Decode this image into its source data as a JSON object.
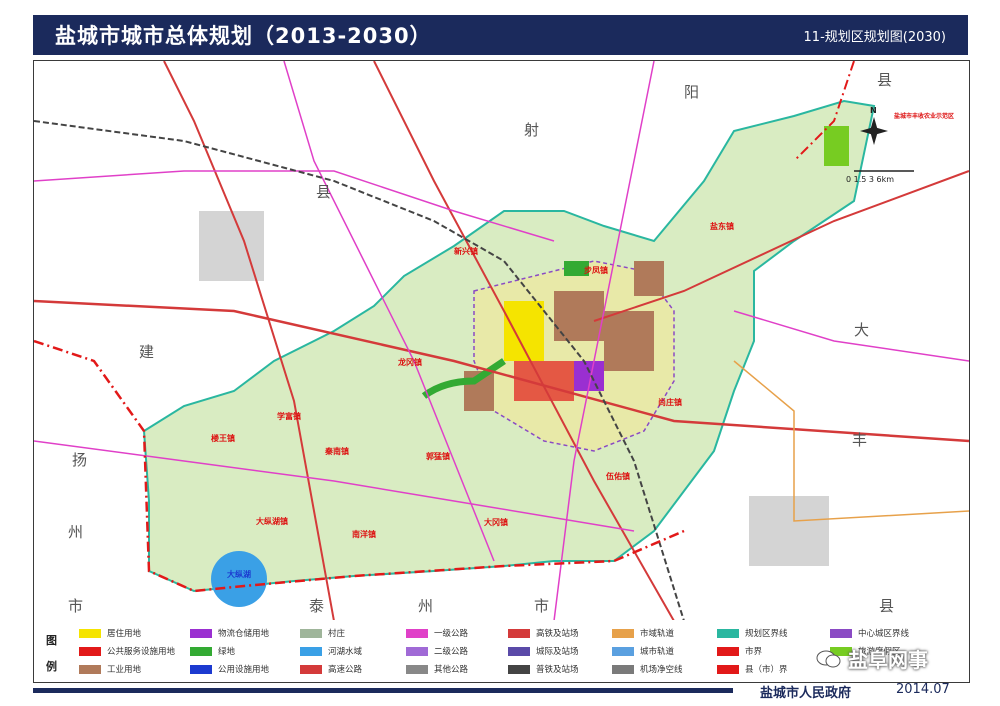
{
  "header": {
    "title": "盐城市城市总体规划（2013-2030）",
    "subtitle": "11-规划区规划图(2030)"
  },
  "map": {
    "region_labels": [
      "县",
      "阳",
      "射",
      "县",
      "建",
      "大",
      "丰",
      "扬",
      "州",
      "市",
      "泰",
      "州",
      "市",
      "县"
    ],
    "towns": [
      "新兴镇",
      "龙冈镇",
      "学富镇",
      "楼王镇",
      "秦南镇",
      "郭猛镇",
      "大冈镇",
      "南洋镇",
      "伍佑镇",
      "大纵湖镇",
      "尚庄镇",
      "盐东镇",
      "步凤镇"
    ],
    "lake_label": "大纵湖",
    "north_label": "N",
    "scale_label": "0 1.5 3 6km",
    "note": "盐城市丰收农业示范区"
  },
  "legend": {
    "title": "图例",
    "items": [
      {
        "label": "居住用地",
        "color": "#f5e400"
      },
      {
        "label": "物流仓储用地",
        "color": "#9a2fd1"
      },
      {
        "label": "村庄",
        "color": "#9fb59a"
      },
      {
        "label": "一级公路",
        "color": "#e040c8"
      },
      {
        "label": "高铁及站场",
        "color": "#d43a3a"
      },
      {
        "label": "市域轨道",
        "color": "#e7a14a"
      },
      {
        "label": "规划区界线",
        "color": "#2ab7a0"
      },
      {
        "label": "中心城区界线",
        "color": "#8a4ac4"
      },
      {
        "label": "公共服务设施用地",
        "color": "#e21919"
      },
      {
        "label": "绿地",
        "color": "#33aa33"
      },
      {
        "label": "河湖水域",
        "color": "#3aa0e6"
      },
      {
        "label": "二级公路",
        "color": "#a06ad6"
      },
      {
        "label": "城际及站场",
        "color": "#5a4aa8"
      },
      {
        "label": "城市轨道",
        "color": "#5aa0e0"
      },
      {
        "label": "市界",
        "color": "#e21919"
      },
      {
        "label": "旅游度假区",
        "color": "#77cc22"
      },
      {
        "label": "工业用地",
        "color": "#b07a5a"
      },
      {
        "label": "公用设施用地",
        "color": "#1c3ad0"
      },
      {
        "label": "高速公路",
        "color": "#d43a3a"
      },
      {
        "label": "其他公路",
        "color": "#888888"
      },
      {
        "label": "普铁及站场",
        "color": "#444444"
      },
      {
        "label": "机场净空线",
        "color": "#7a7a7a"
      },
      {
        "label": "县（市）界",
        "color": "#e21919"
      }
    ]
  },
  "footer": {
    "org": "盐城市人民政府",
    "date": "2014.07"
  },
  "watermark": {
    "text": "盐阜网事"
  }
}
